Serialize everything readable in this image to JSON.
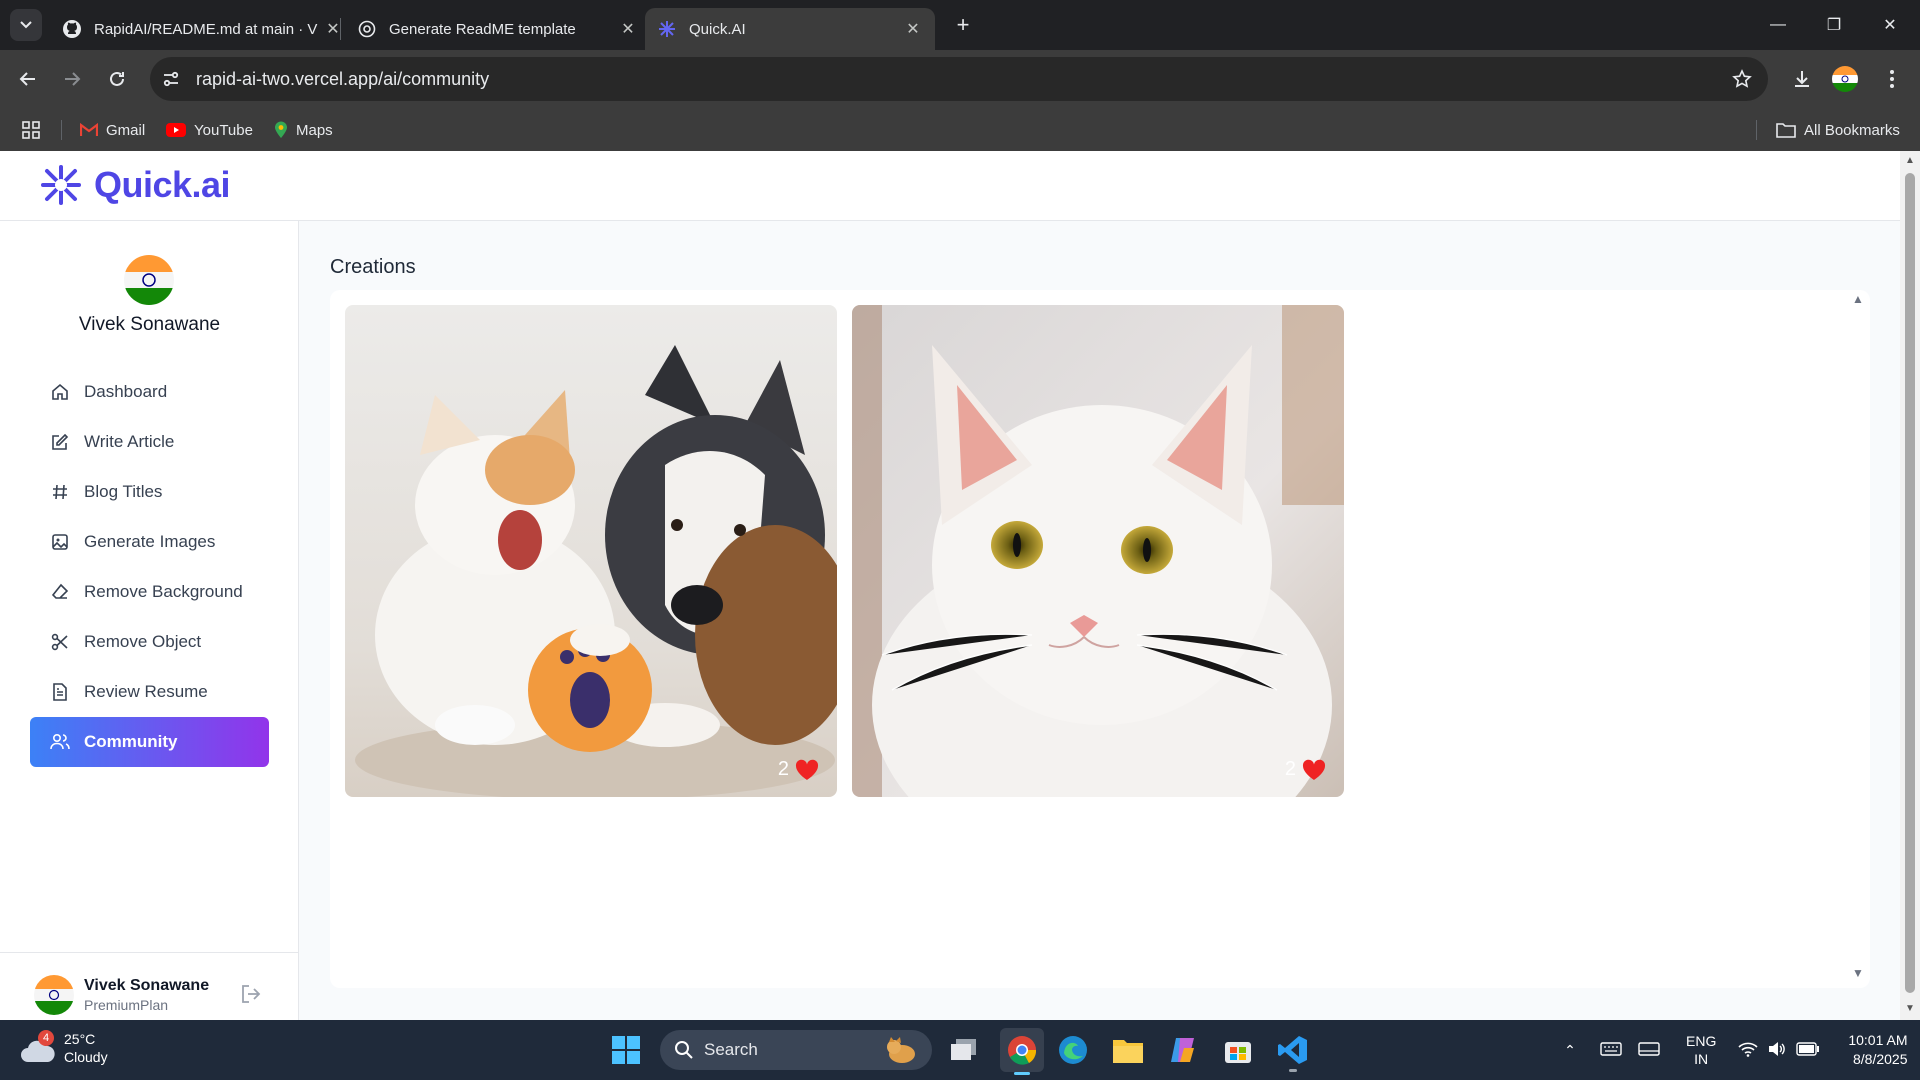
{
  "browser": {
    "tabs": [
      {
        "title": "RapidAI/README.md at main · V",
        "icon": "github-icon"
      },
      {
        "title": "Generate ReadME template",
        "icon": "chatgpt-icon"
      },
      {
        "title": "Quick.AI",
        "icon": "quickai-icon",
        "active": true
      }
    ],
    "url": "rapid-ai-two.vercel.app/ai/community",
    "bookmarks": [
      {
        "label": "Gmail",
        "icon": "gmail-icon"
      },
      {
        "label": "YouTube",
        "icon": "youtube-icon"
      },
      {
        "label": "Maps",
        "icon": "maps-icon"
      }
    ],
    "all_bookmarks": "All Bookmarks"
  },
  "app": {
    "logo": "Quick.ai",
    "brand_color": "#4f46e5",
    "user_name": "Vivek Sonawane",
    "menu": [
      {
        "label": "Dashboard",
        "icon": "home-icon"
      },
      {
        "label": "Write Article",
        "icon": "edit-icon"
      },
      {
        "label": "Blog Titles",
        "icon": "hash-icon"
      },
      {
        "label": "Generate Images",
        "icon": "image-icon"
      },
      {
        "label": "Remove Background",
        "icon": "eraser-icon"
      },
      {
        "label": "Remove Object",
        "icon": "scissors-icon"
      },
      {
        "label": "Review Resume",
        "icon": "file-text-icon"
      },
      {
        "label": "Community",
        "icon": "users-icon",
        "active": true
      }
    ],
    "footer": {
      "name": "Vivek Sonawane",
      "plan": "PremiumPlan"
    },
    "main_title": "Creations",
    "creations": [
      {
        "subject": "kitten and husky with orange ball",
        "likes": "2"
      },
      {
        "subject": "white cat portrait",
        "likes": "2"
      }
    ]
  },
  "taskbar": {
    "weather": {
      "temp": "25°C",
      "cond": "Cloudy",
      "badge": "4"
    },
    "search": "Search",
    "lang": "ENG",
    "region": "IN",
    "time": "10:01 AM",
    "date": "8/8/2025"
  }
}
